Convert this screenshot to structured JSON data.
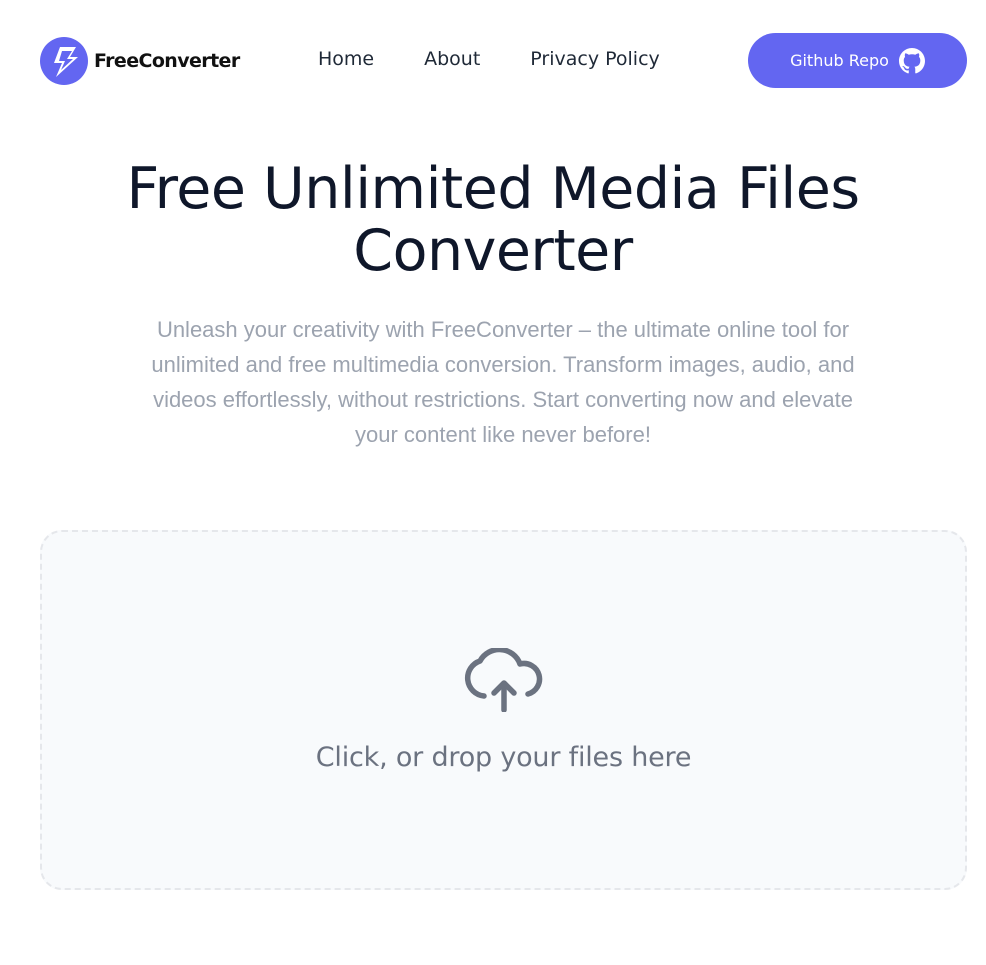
{
  "header": {
    "brand": "FreeConverter",
    "nav": {
      "home": "Home",
      "about": "About",
      "privacy": "Privacy Policy"
    },
    "github_label": "Github Repo"
  },
  "hero": {
    "title_line1": "Free Unlimited Media Files",
    "title_line2": "Converter",
    "description": "Unleash your creativity with FreeConverter – the ultimate online tool for unlimited and free multimedia conversion. Transform images, audio, and videos effortlessly, without restrictions. Start converting now and elevate your content like never before!"
  },
  "dropzone": {
    "label": "Click, or drop your files here",
    "icon": "cloud-upload-icon"
  },
  "colors": {
    "accent": "#6366f1",
    "title": "#0f172a",
    "muted": "#9ca3af",
    "dropzone_bg": "#f8fafc"
  }
}
